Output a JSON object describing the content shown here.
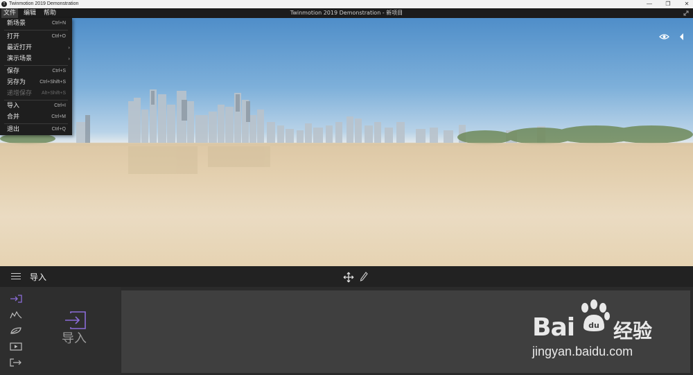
{
  "window": {
    "title": "Twinmotion 2019 Demonstration",
    "project_title": "Twinmotion 2019 Demonstration - 新项目",
    "controls": [
      "—",
      "❐",
      "✕"
    ]
  },
  "menubar": {
    "items": [
      "文件",
      "编辑",
      "帮助"
    ],
    "active_item": "文件"
  },
  "file_menu": {
    "items": [
      {
        "label": "新场景",
        "shortcut": "Ctrl+N"
      },
      {
        "label": "打开",
        "shortcut": "Ctrl+O"
      },
      {
        "label": "最近打开",
        "submenu_arrow": "›"
      },
      {
        "label": "演示场景",
        "submenu_arrow": "›"
      },
      {
        "label": "保存",
        "shortcut": "Ctrl+S"
      },
      {
        "label": "另存为",
        "shortcut": "Ctrl+Shift+S"
      },
      {
        "label": "递增保存",
        "shortcut": "Alt+Shift+S",
        "disabled": true
      },
      {
        "label": "导入",
        "shortcut": "Ctrl+I"
      },
      {
        "label": "合并",
        "shortcut": "Ctrl+M"
      },
      {
        "label": "退出",
        "shortcut": "Ctrl+Q"
      }
    ]
  },
  "toolbar": {
    "section_title": "导入",
    "icons": [
      "hamburger-menu-icon",
      "move-gizmo-icon",
      "pencil-icon"
    ]
  },
  "left_panel": {
    "tools": [
      "import-icon",
      "terrain-icon",
      "vegetation-icon",
      "media-icon",
      "export-icon"
    ],
    "big_label": "导入",
    "active_color": "#8a6cd8"
  },
  "viewport": {
    "icons": [
      "eye-icon",
      "collapse-arrow-icon"
    ]
  },
  "watermark": {
    "brand": "Bai",
    "brand_suffix": "经验",
    "url": "jingyan.baidu.com"
  }
}
